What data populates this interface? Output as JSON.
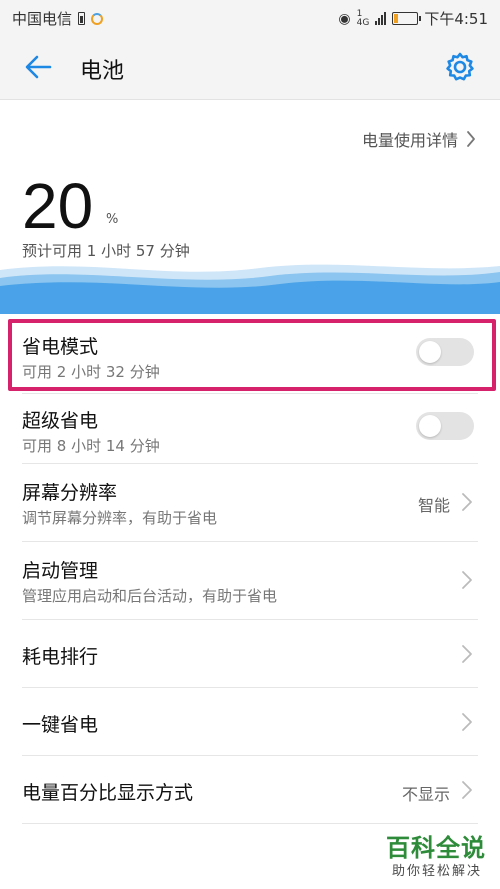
{
  "status_bar": {
    "carrier": "中国电信",
    "net_top": "4G",
    "net_bottom": "1",
    "time": "下午4:51",
    "battery_level": 0.2
  },
  "app_bar": {
    "title": "电池"
  },
  "battery": {
    "detail_link": "电量使用详情",
    "percent": "20",
    "percent_unit": "%",
    "remaining": "预计可用 1 小时 57 分钟"
  },
  "settings": [
    {
      "title": "省电模式",
      "subtitle": "可用 2 小时 32 分钟",
      "control": "toggle",
      "enabled": false
    },
    {
      "title": "超级省电",
      "subtitle": "可用 8 小时 14 分钟",
      "control": "toggle",
      "enabled": false
    },
    {
      "title": "屏幕分辨率",
      "subtitle": "调节屏幕分辨率，有助于省电",
      "control": "chevron",
      "value": "智能"
    },
    {
      "title": "启动管理",
      "subtitle": "管理应用启动和后台活动，有助于省电",
      "control": "chevron"
    },
    {
      "title": "耗电排行",
      "control": "chevron"
    },
    {
      "title": "一键省电",
      "control": "chevron"
    },
    {
      "title": "电量百分比显示方式",
      "control": "chevron",
      "value": "不显示"
    }
  ],
  "watermark": {
    "title": "百科全说",
    "subtitle": "助你轻松解决"
  },
  "colors": {
    "accent": "#1e88e5",
    "highlight": "#d6226b",
    "wave": "#4aa3e8",
    "watermark": "#2e8b3a"
  }
}
